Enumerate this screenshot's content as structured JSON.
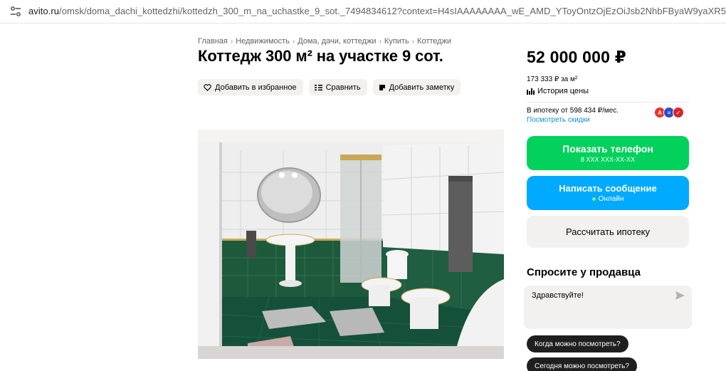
{
  "browser": {
    "url_host": "avito.ru",
    "url_path": "/omsk/doma_dachi_kottedzhi/kottedzh_300_m_na_uchastke_9_sot._7494834612?context=H4sIAAAAAAAA_wE_AMD_YToyOntzOjEzOiJsb2NhbFByaW9yaXR5IjtiOjA7czoxOiJ4IjtzOjE2"
  },
  "breadcrumb": {
    "items": [
      "Главная",
      "Недвижимость",
      "Дома, дачи, коттеджи",
      "Купить",
      "Коттеджи"
    ],
    "separator": "›"
  },
  "listing": {
    "title": "Коттедж 300 м² на участке 9 сот."
  },
  "actions": {
    "favorite": "Добавить в избранное",
    "compare": "Сравнить",
    "note": "Добавить заметку"
  },
  "pricing": {
    "price": "52 000 000 ₽",
    "per_m2": "173 333 ₽ за м²",
    "history": "История цены",
    "mortgage_text": "В ипотеку от 598 434 ₽/мес.",
    "discounts_link": "Посмотреть скидки"
  },
  "contact": {
    "show_phone": "Показать телефон",
    "phone_mask": "8 XXX XXX-XX-XX",
    "write_message": "Написать сообщение",
    "online": "Онлайн",
    "calc_mortgage": "Рассчитать ипотеку"
  },
  "ask": {
    "title": "Спросите у продавца",
    "message": "Здравствуйте!",
    "chips": [
      "Когда можно посмотреть?",
      "Сегодня можно посмотреть?"
    ]
  },
  "colors": {
    "green": "#02d15c",
    "blue": "#00aaff",
    "link": "#0a8ed9",
    "chip": "#1f1f1f"
  }
}
